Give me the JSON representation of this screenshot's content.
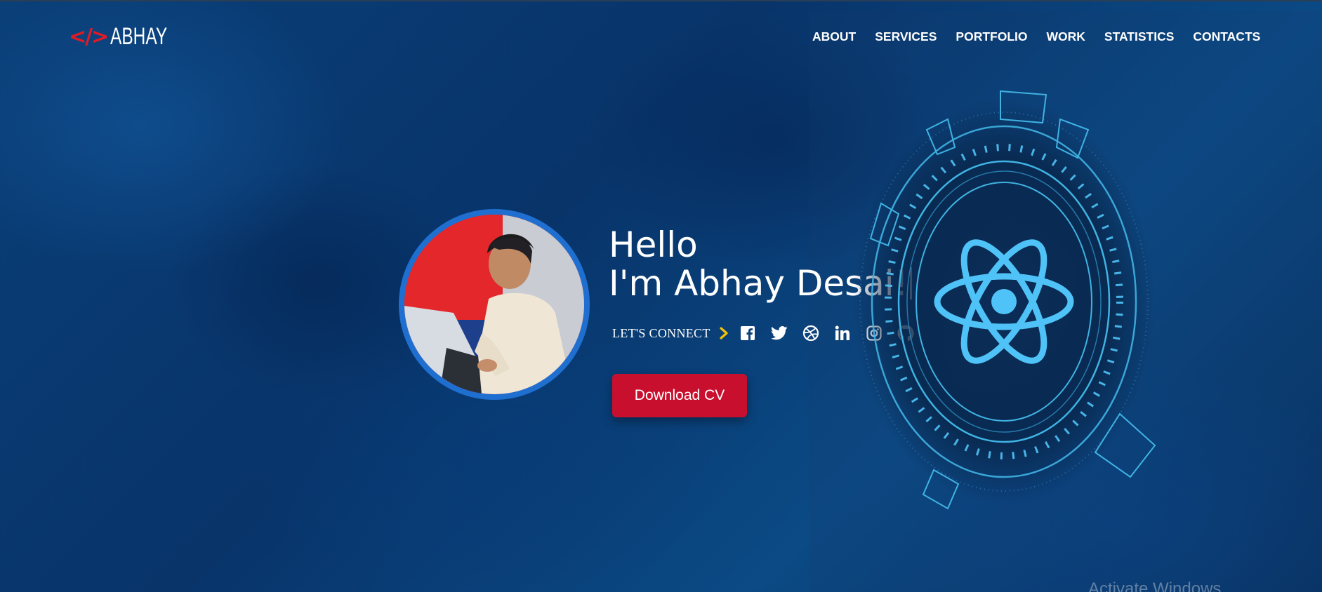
{
  "brand": {
    "logo_mark": "</>",
    "logo_text": "ABHAY",
    "accent_color": "#e01b24"
  },
  "nav": {
    "items": [
      {
        "label": "ABOUT"
      },
      {
        "label": "SERVICES"
      },
      {
        "label": "PORTFOLIO"
      },
      {
        "label": "WORK"
      },
      {
        "label": "STATISTICS"
      },
      {
        "label": "CONTACTS"
      }
    ]
  },
  "hero": {
    "greeting_line1": "Hello",
    "greeting_line2": "I'm Abhay Desai!",
    "connect_label": "LET'S CONNECT",
    "social_icons": [
      "facebook-icon",
      "twitter-icon",
      "dribbble-icon",
      "linkedin-icon",
      "instagram-icon",
      "github-icon"
    ],
    "cta_label": "Download CV",
    "cta_color": "#c8102e",
    "avatar_ring_color": "#1f6fd0",
    "chevron_color": "#f5c400"
  },
  "graphic": {
    "icon": "react-atom-icon",
    "color": "#4fc3f7"
  },
  "system": {
    "watermark": "Activate Windows"
  }
}
